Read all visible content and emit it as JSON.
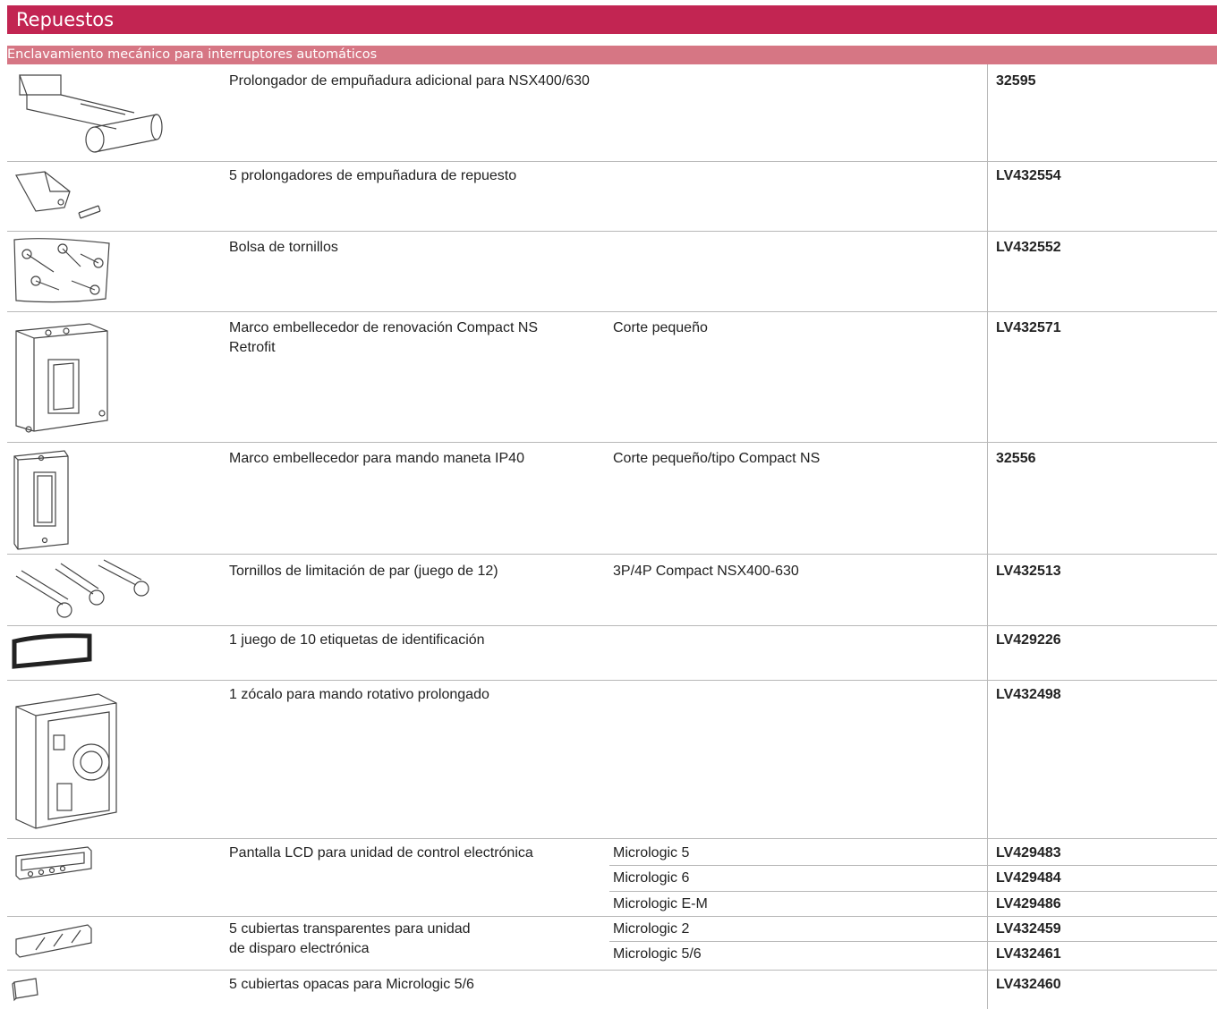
{
  "header": {
    "title": "Repuestos",
    "subtitle": "Enclavamiento mecánico para interruptores automáticos"
  },
  "colors": {
    "title_bar": "#c22552",
    "sub_bar": "#d67684"
  },
  "rows": [
    {
      "icon": "handle-extension-icon",
      "description": "Prolongador de empuñadura adicional para NSX400/630",
      "variants": [
        ""
      ],
      "codes": [
        "32595"
      ]
    },
    {
      "icon": "handle-extender-spare-icon",
      "description": "5 prolongadores de empuñadura de repuesto",
      "variants": [
        ""
      ],
      "codes": [
        "LV432554"
      ]
    },
    {
      "icon": "screw-bag-icon",
      "description": "Bolsa de tornillos",
      "variants": [
        ""
      ],
      "codes": [
        "LV432552"
      ]
    },
    {
      "icon": "retrofit-frame-icon",
      "description": "Marco embellecedor de renovación Compact NS\nRetrofit",
      "variants": [
        "Corte pequeño"
      ],
      "codes": [
        "LV432571"
      ]
    },
    {
      "icon": "escutcheon-frame-icon",
      "description": "Marco embellecedor para mando maneta IP40",
      "variants": [
        "Corte pequeño/tipo Compact NS"
      ],
      "codes": [
        "32556"
      ]
    },
    {
      "icon": "torque-screws-icon",
      "description": "Tornillos de limitación de par (juego de 12)",
      "variants": [
        "3P/4P Compact NSX400-630"
      ],
      "codes": [
        "LV432513"
      ]
    },
    {
      "icon": "label-holder-icon",
      "description": "1 juego de 10 etiquetas de identificación",
      "variants": [
        ""
      ],
      "codes": [
        "LV429226"
      ]
    },
    {
      "icon": "rotary-handle-base-icon",
      "description": "1 zócalo para mando rotativo prolongado",
      "variants": [
        ""
      ],
      "codes": [
        "LV432498"
      ]
    },
    {
      "icon": "lcd-display-icon",
      "description": "Pantalla LCD para unidad de control electrónica",
      "variants": [
        "Micrologic 5",
        "Micrologic 6",
        "Micrologic E-M"
      ],
      "codes": [
        "LV429483",
        "LV429484",
        "LV429486"
      ]
    },
    {
      "icon": "transparent-cover-icon",
      "description": "5 cubiertas transparentes para unidad\nde disparo electrónica",
      "variants": [
        "Micrologic 2",
        "Micrologic 5/6"
      ],
      "codes": [
        "LV432459",
        "LV432461"
      ]
    },
    {
      "icon": "opaque-cover-icon",
      "description": "5 cubiertas opacas para Micrologic 5/6",
      "variants": [
        ""
      ],
      "codes": [
        "LV432460"
      ]
    }
  ]
}
